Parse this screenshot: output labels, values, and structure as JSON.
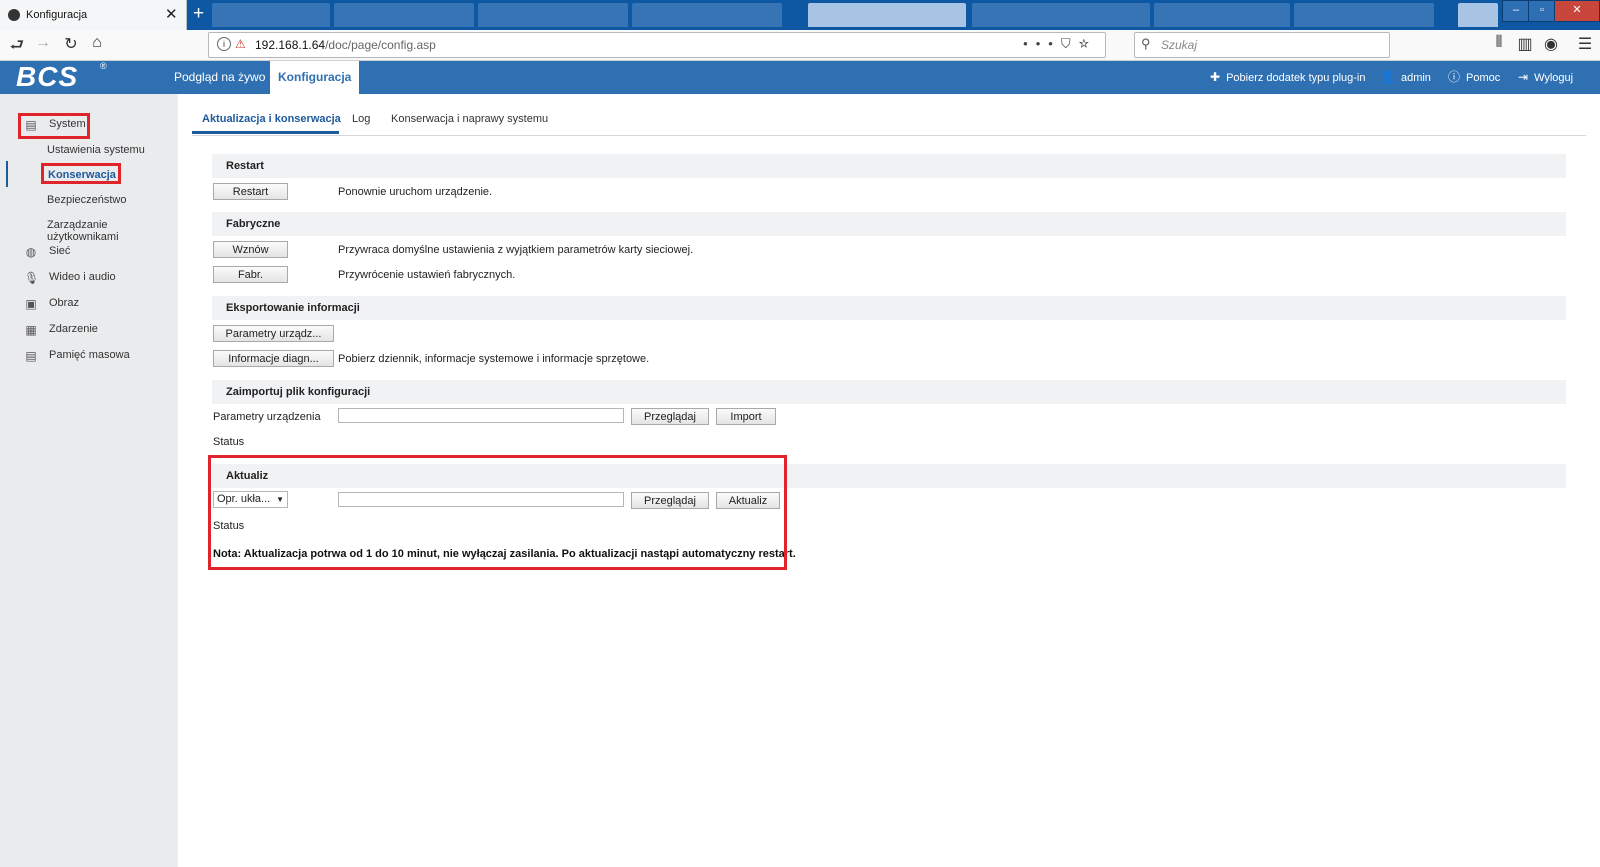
{
  "browser": {
    "tab_title": "Konfiguracja",
    "url_host": "192.168.1.64",
    "url_path": "/doc/page/config.asp",
    "search_placeholder": "Szukaj"
  },
  "header": {
    "logo": "BCS",
    "logo_mark": "®",
    "nav": [
      {
        "label": "Podgląd na żywo"
      },
      {
        "label": "Konfiguracja",
        "active": true
      }
    ],
    "links": {
      "plugin": "Pobierz dodatek typu plug-in",
      "user": "admin",
      "help": "Pomoc",
      "logout": "Wyloguj"
    },
    "accent": "#2e70b2"
  },
  "sidebar": {
    "system": "System",
    "items": {
      "ustawienia": "Ustawienia systemu",
      "konserwacja": "Konserwacja",
      "bezpieczenstwo": "Bezpieczeństwo",
      "uzytkownicy": "Zarządzanie użytkownikami",
      "siec": "Sieć",
      "wideo": "Wideo i audio",
      "obraz": "Obraz",
      "zdarzenie": "Zdarzenie",
      "pamiec": "Pamięć masowa"
    },
    "highlight_color": "#e0242c"
  },
  "subtabs": {
    "t1": "Aktualizacja i konserwacja",
    "t2": "Log",
    "t3": "Konserwacja i naprawy systemu"
  },
  "sections": {
    "restart": {
      "title": "Restart",
      "button": "Restart",
      "desc": "Ponownie uruchom urządzenie."
    },
    "fabryczne": {
      "title": "Fabryczne",
      "wznow_button": "Wznów",
      "wznow_desc": "Przywraca domyślne ustawienia z wyjątkiem parametrów karty sieciowej.",
      "fabr_button": "Fabr.",
      "fabr_desc": "Przywrócenie ustawień fabrycznych."
    },
    "eksport": {
      "title": "Eksportowanie informacji",
      "params_button": "Parametry urządz...",
      "diag_button": "Informacje diagn...",
      "diag_desc": "Pobierz dziennik, informacje systemowe i informacje sprzętowe."
    },
    "import": {
      "title": "Zaimportuj plik konfiguracji",
      "label": "Parametry urządzenia",
      "browse_button": "Przeglądaj",
      "import_button": "Import",
      "status_label": "Status"
    },
    "aktualiz": {
      "title": "Aktualiz",
      "select_value": "Opr. ukła...",
      "browse_button": "Przeglądaj",
      "update_button": "Aktualiz",
      "status_label": "Status",
      "note": "Nota: Aktualizacja potrwa od 1 do 10 minut, nie wyłączaj zasilania. Po aktualizacji nastąpi automatyczny restart."
    }
  }
}
